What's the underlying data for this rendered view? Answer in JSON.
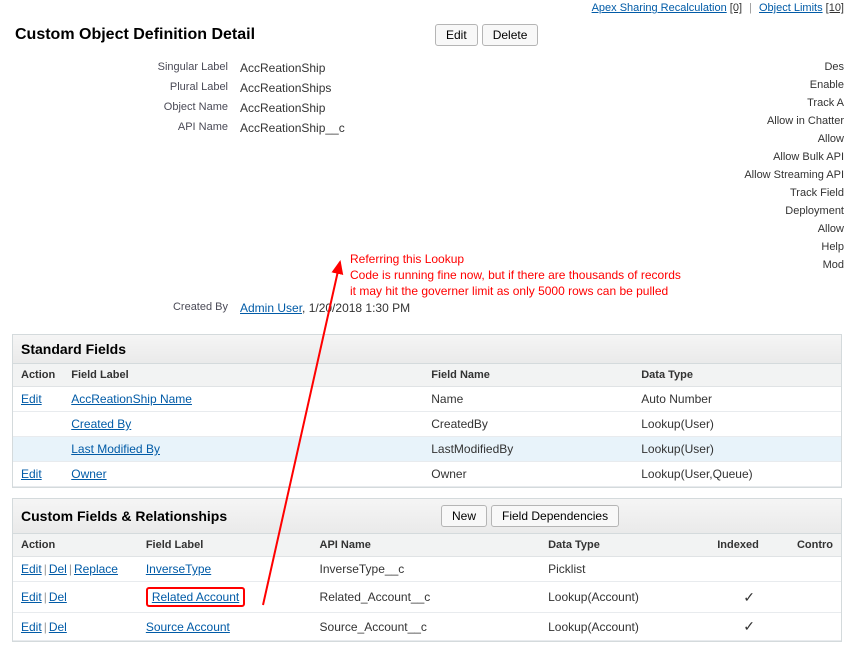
{
  "top_links": {
    "link1": "Apex Sharing Recalculation",
    "count1": "[0]",
    "sep": "|",
    "link2": "Object Limits",
    "count2": "[10]"
  },
  "header": {
    "title": "Custom Object Definition Detail",
    "edit": "Edit",
    "delete": "Delete"
  },
  "details": {
    "singular_label_lbl": "Singular Label",
    "singular_label_val": "AccReationShip",
    "plural_label_lbl": "Plural Label",
    "plural_label_val": "AccReationShips",
    "object_name_lbl": "Object Name",
    "object_name_val": "AccReationShip",
    "api_name_lbl": "API Name",
    "api_name_val": "AccReationShip__c",
    "created_by_lbl": "Created By",
    "created_by_user": "Admin User",
    "created_by_date": ", 1/20/2018 1:30 PM"
  },
  "right_labels": [
    "Des",
    "Enable",
    "Track A",
    "Allow in Chatter",
    "Allow",
    "Allow Bulk API",
    "Allow Streaming API",
    "Track Field",
    "Deployment",
    "Allow",
    "Help",
    "Mod"
  ],
  "annotation": {
    "line1": "Referring this Lookup",
    "line2": "Code is running fine now, but if there are thousands of records",
    "line3": "it may hit the governer limit as only 5000 rows can be pulled"
  },
  "std_fields": {
    "title": "Standard Fields",
    "cols": {
      "action": "Action",
      "field_label": "Field Label",
      "field_name": "Field Name",
      "data_type": "Data Type"
    },
    "rows": [
      {
        "action": "Edit",
        "label": "AccReationShip Name",
        "name": "Name",
        "type": "Auto Number",
        "highlight": false
      },
      {
        "action": "",
        "label": "Created By",
        "name": "CreatedBy",
        "type": "Lookup(User)",
        "highlight": false
      },
      {
        "action": "",
        "label": "Last Modified By",
        "name": "LastModifiedBy",
        "type": "Lookup(User)",
        "highlight": true
      },
      {
        "action": "Edit",
        "label": "Owner",
        "name": "Owner",
        "type": "Lookup(User,Queue)",
        "highlight": false
      }
    ]
  },
  "custom_fields": {
    "title": "Custom Fields & Relationships",
    "new_btn": "New",
    "dep_btn": "Field Dependencies",
    "cols": {
      "action": "Action",
      "field_label": "Field Label",
      "api_name": "API Name",
      "data_type": "Data Type",
      "indexed": "Indexed",
      "contro": "Contro"
    },
    "actions": {
      "edit": "Edit",
      "del": "Del",
      "replace": "Replace"
    },
    "rows": [
      {
        "has_replace": true,
        "label": "InverseType",
        "api": "InverseType__c",
        "type": "Picklist",
        "indexed": false,
        "boxed": false
      },
      {
        "has_replace": false,
        "label": "Related Account",
        "api": "Related_Account__c",
        "type": "Lookup(Account)",
        "indexed": true,
        "boxed": true
      },
      {
        "has_replace": false,
        "label": "Source Account",
        "api": "Source_Account__c",
        "type": "Lookup(Account)",
        "indexed": true,
        "boxed": false
      }
    ]
  }
}
